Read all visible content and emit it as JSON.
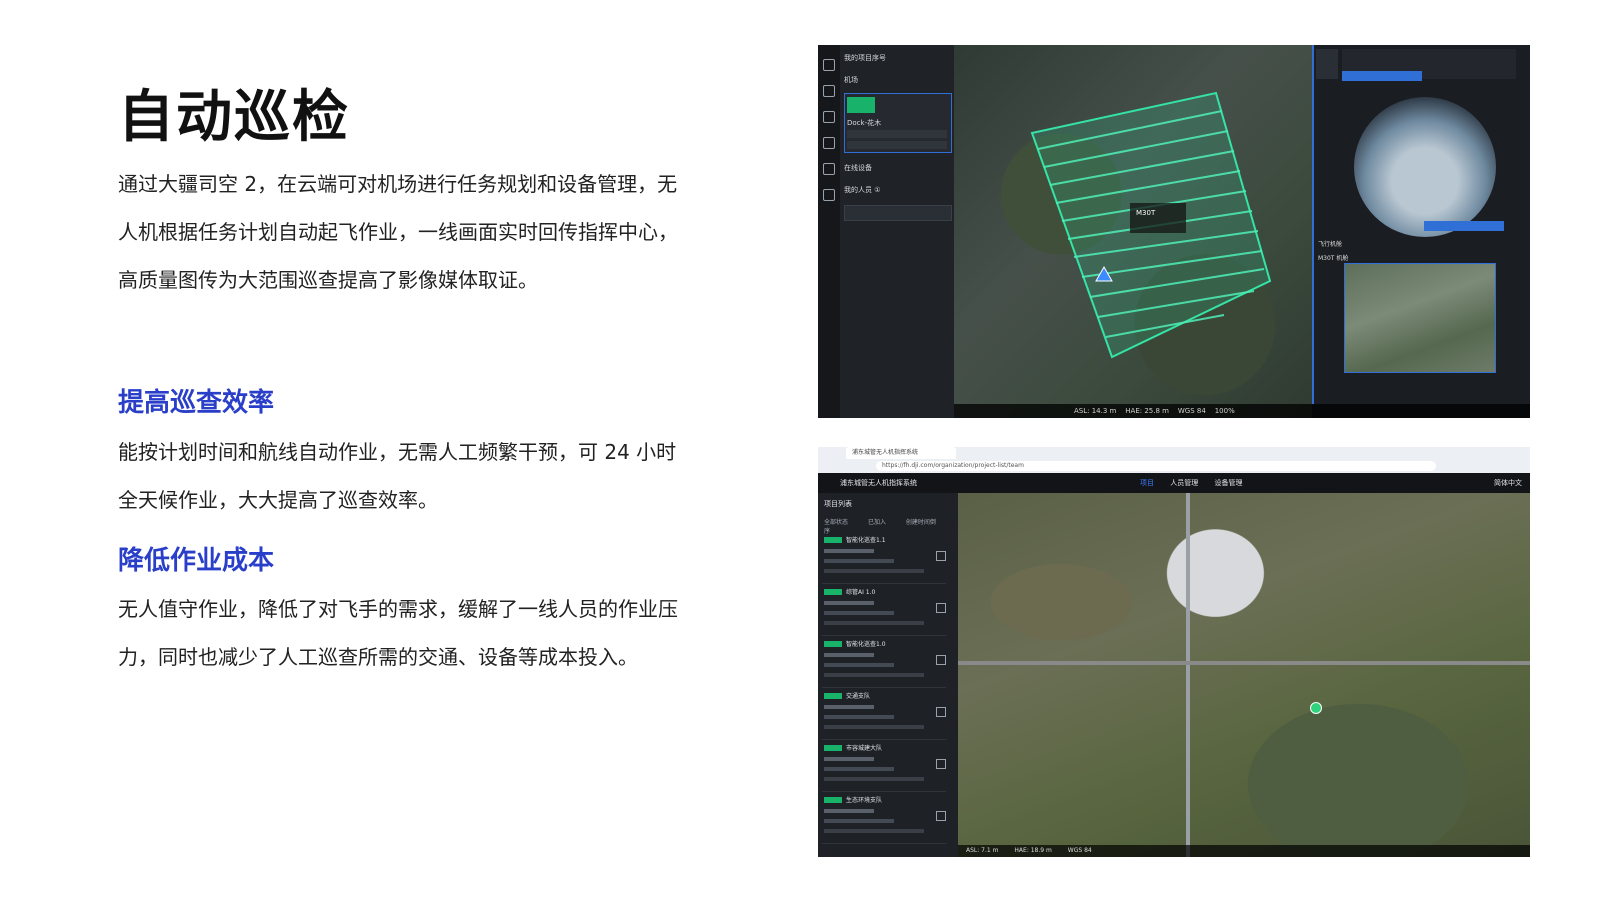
{
  "page": {
    "title": "自动巡检",
    "intro": "通过大疆司空 2，在云端可对机场进行任务规划和设备管理，无人机根据任务计划自动起飞作业，一线画面实时回传指挥中心，高质量图传为大范围巡查提高了影像媒体取证。",
    "section1_title": "提高巡查效率",
    "section1_text": "能按计划时间和航线自动作业，无需人工频繁干预，可 24 小时全天候作业，大大提高了巡查效率。",
    "section2_title": "降低作业成本",
    "section2_text": "无人值守作业，降低了对飞手的需求，缓解了一线人员的作业压力，同时也减少了人工巡查所需的交通、设备等成本投入。",
    "accent_color": "#2a3fc9"
  },
  "screenshot1": {
    "panel_header": "我的项目序号",
    "section_dock": "机场",
    "dock_name": "Dock-花木",
    "section_online": "在线设备",
    "section_group": "我的人员 ①",
    "drone_label": "M30T",
    "status_asl": "ASL: 14.3 m",
    "status_hae": "HAE: 25.8 m",
    "status_wgs": "WGS 84",
    "status_zoom": "100%",
    "camera_label": "M30T 机舱",
    "right_tab": "飞行机舱"
  },
  "screenshot2": {
    "tab_title": "浦东城管无人机指挥系统",
    "url": "https://fh.dji.com/organization/project-list/team",
    "brand": "浦东城管无人机指挥系统",
    "nav": [
      "项目",
      "人员管理",
      "设备管理"
    ],
    "user": "简体中文",
    "list_header": "项目列表",
    "filters": [
      "全部状态",
      "已加入",
      "创建时间倒序"
    ],
    "projects": [
      {
        "name": "智能化巡查1.1"
      },
      {
        "name": "综管AI 1.0"
      },
      {
        "name": "智能化巡查1.0"
      },
      {
        "name": "交通支队"
      },
      {
        "name": "市容城建大队"
      },
      {
        "name": "生态环境支队"
      }
    ],
    "status_asl": "ASL: 7.1 m",
    "status_hae": "HAE: 18.9 m",
    "status_wgs": "WGS 84"
  }
}
